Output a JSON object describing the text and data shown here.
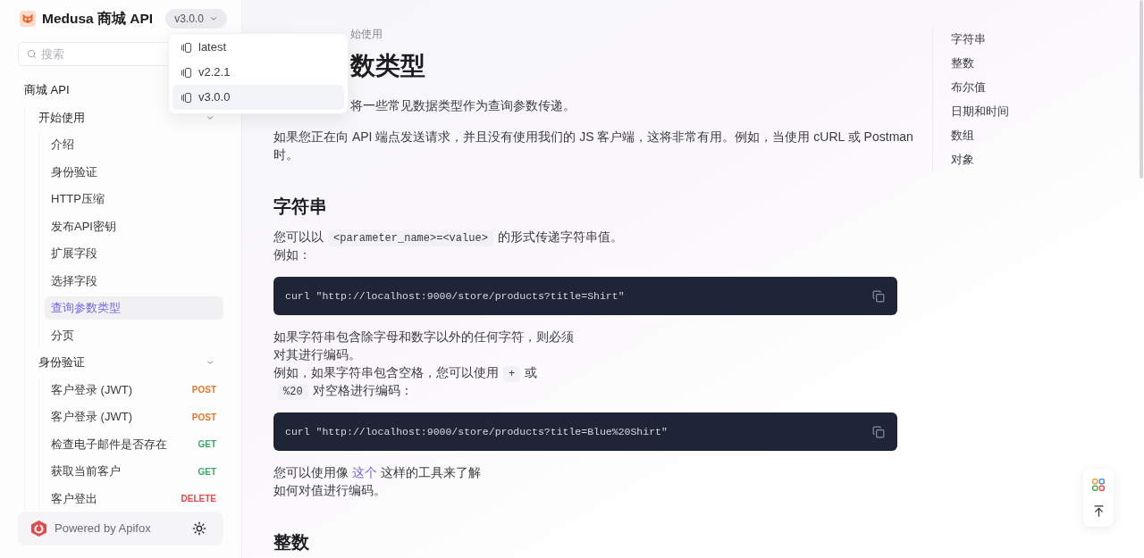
{
  "header": {
    "title": "Medusa 商城 API"
  },
  "version_menu": {
    "label": "v3.0.0",
    "open": true,
    "items": [
      {
        "label": "latest",
        "selected": false
      },
      {
        "label": "v2.2.1",
        "selected": false
      },
      {
        "label": "v3.0.0",
        "selected": true
      }
    ]
  },
  "search": {
    "placeholder": "搜索"
  },
  "sidebar": {
    "section": "商城 API",
    "groups": [
      {
        "label": "开始使用",
        "expanded": true,
        "items": [
          {
            "label": "介绍",
            "selected": false
          },
          {
            "label": "身份验证",
            "selected": false
          },
          {
            "label": "HTTP压缩",
            "selected": false
          },
          {
            "label": "发布API密钥",
            "selected": false
          },
          {
            "label": "扩展字段",
            "selected": false
          },
          {
            "label": "选择字段",
            "selected": false
          },
          {
            "label": "查询参数类型",
            "selected": true
          },
          {
            "label": "分页",
            "selected": false
          }
        ]
      },
      {
        "label": "身份验证",
        "expanded": true,
        "items": [
          {
            "label": "客户登录 (JWT)",
            "selected": false,
            "method": {
              "text": "POST",
              "color": "#e0782f"
            }
          },
          {
            "label": "客户登录 (JWT)",
            "selected": false,
            "method": {
              "text": "POST",
              "color": "#e0782f"
            }
          },
          {
            "label": "检查电子邮件是否存在",
            "selected": false,
            "method": {
              "text": "GET",
              "color": "#3aa76d"
            }
          },
          {
            "label": "获取当前客户",
            "selected": false,
            "method": {
              "text": "GET",
              "color": "#3aa76d"
            }
          },
          {
            "label": "客户登出",
            "selected": false,
            "method": {
              "text": "DELETE",
              "color": "#e5484d"
            }
          }
        ]
      }
    ]
  },
  "footer": {
    "label": "Powered by Apifox"
  },
  "breadcrumb": [
    "始使用"
  ],
  "article": {
    "title": "数类型",
    "lead": "将一些常见数据类型作为查询参数传递。",
    "blocks": [
      {
        "kind": "paragraph",
        "segments": [
          {
            "kind": "text",
            "text": "如果您正在向 API 端点发送请求，并且没有使用我们的 JS 客户端，这将非常有用。例如，当使用 cURL 或 Postman 时。"
          }
        ]
      },
      {
        "kind": "heading",
        "text": "字符串"
      },
      {
        "kind": "paragraph",
        "segments": [
          {
            "kind": "text",
            "text": "您可以以"
          },
          {
            "kind": "code",
            "text": "<parameter_name>=<value>"
          },
          {
            "kind": "text",
            "text": "的形式传递字符串值。"
          },
          {
            "kind": "break"
          },
          {
            "kind": "text",
            "text": "例如："
          }
        ]
      },
      {
        "kind": "code",
        "text": "curl \"http://localhost:9000/store/products?title=Shirt\""
      },
      {
        "kind": "paragraph",
        "segments": [
          {
            "kind": "text",
            "text": "如果字符串包含除字母和数字以外的任何字符，则必须"
          },
          {
            "kind": "break"
          },
          {
            "kind": "text",
            "text": "对其进行编码。"
          },
          {
            "kind": "break"
          },
          {
            "kind": "text",
            "text": "例如，如果字符串包含空格，您可以使用"
          },
          {
            "kind": "code",
            "text": "+"
          },
          {
            "kind": "text",
            "text": "或"
          },
          {
            "kind": "break"
          },
          {
            "kind": "code",
            "text": "%20"
          },
          {
            "kind": "text",
            "text": "对空格进行编码："
          }
        ]
      },
      {
        "kind": "code",
        "text": "curl \"http://localhost:9000/store/products?title=Blue%20Shirt\""
      },
      {
        "kind": "paragraph",
        "segments": [
          {
            "kind": "text",
            "text": "您可以使用像 "
          },
          {
            "kind": "link",
            "text": "这个"
          },
          {
            "kind": "text",
            "text": " 这样的工具来了解"
          },
          {
            "kind": "break"
          },
          {
            "kind": "text",
            "text": "如何对值进行编码。"
          }
        ]
      },
      {
        "kind": "heading",
        "text": "整数"
      }
    ]
  },
  "toc": [
    "字符串",
    "整数",
    "布尔值",
    "日期和时间",
    "数组",
    "对象"
  ]
}
